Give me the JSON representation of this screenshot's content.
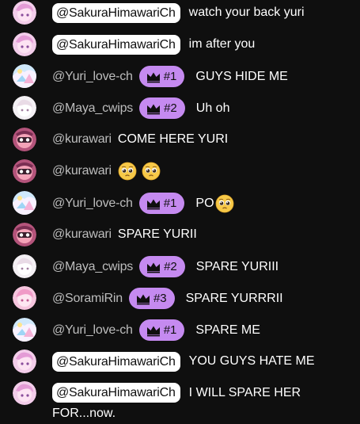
{
  "messages": [
    {
      "author": "@SakuraHimawariCh",
      "author_style": "pill",
      "avatar": "sakura-avatar-icon",
      "badge": "",
      "text": "watch your back yuri"
    },
    {
      "author": "@SakuraHimawariCh",
      "author_style": "pill",
      "avatar": "sakura-avatar-icon",
      "badge": "",
      "text": "im after you"
    },
    {
      "author": "@Yuri_love-ch",
      "author_style": "plain",
      "avatar": "yuri-avatar-icon",
      "badge": "#1",
      "text": "GUYS HIDE ME"
    },
    {
      "author": "@Maya_cwips",
      "author_style": "plain",
      "avatar": "maya-avatar-icon",
      "badge": "#2",
      "text": "Uh oh"
    },
    {
      "author": "@kurawari",
      "author_style": "plain",
      "avatar": "kurawari-avatar-icon",
      "badge": "",
      "text": "COME HERE YURI"
    },
    {
      "author": "@kurawari",
      "author_style": "plain",
      "avatar": "kurawari-avatar-icon",
      "badge": "",
      "text": "",
      "emojis": 2
    },
    {
      "author": "@Yuri_love-ch",
      "author_style": "plain",
      "avatar": "yuri-avatar-icon",
      "badge": "#1",
      "text": "PO",
      "emojis": 1
    },
    {
      "author": "@kurawari",
      "author_style": "plain",
      "avatar": "kurawari-avatar-icon",
      "badge": "",
      "text": "SPARE YURII"
    },
    {
      "author": "@Maya_cwips",
      "author_style": "plain",
      "avatar": "maya-avatar-icon",
      "badge": "#2",
      "text": "SPARE YURIII"
    },
    {
      "author": "@SoramiRin",
      "author_style": "plain",
      "avatar": "sorami-avatar-icon",
      "badge": "#3",
      "text": "SPARE YURRRII"
    },
    {
      "author": "@Yuri_love-ch",
      "author_style": "plain",
      "avatar": "yuri-avatar-icon",
      "badge": "#1",
      "text": "SPARE ME"
    },
    {
      "author": "@SakuraHimawariCh",
      "author_style": "pill",
      "avatar": "sakura-avatar-icon",
      "badge": "",
      "text": "YOU GUYS HATE ME"
    },
    {
      "author": "@SakuraHimawariCh",
      "author_style": "pill",
      "avatar": "sakura-avatar-icon",
      "badge": "",
      "text": "I WILL SPARE HER FOR...now."
    }
  ],
  "colors": {
    "background": "#0f0f0f",
    "badge": "#c58af0",
    "author": "#bdbdbd",
    "owner_pill": "#ffffff"
  },
  "icons": {
    "badge": "crown-icon",
    "emoji": "pleading-face-emoji-icon"
  }
}
